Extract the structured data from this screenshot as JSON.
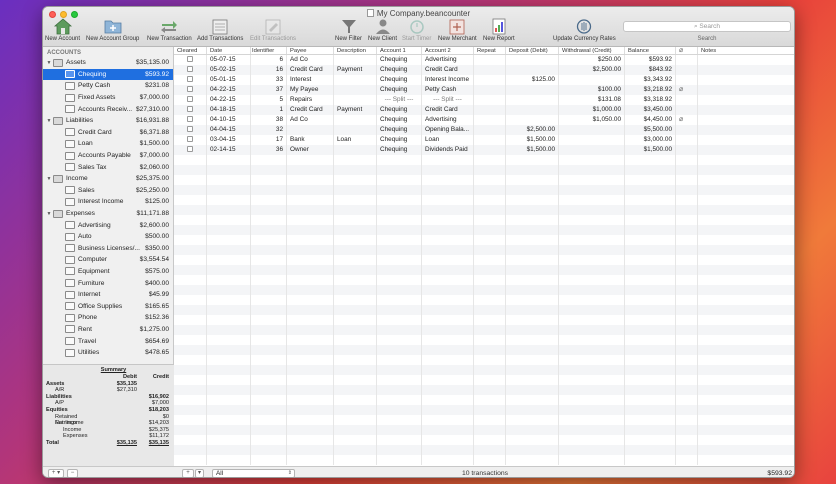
{
  "window": {
    "title": "My Company.beancounter"
  },
  "toolbar": {
    "new_account": "New Account",
    "new_account_group": "New Account Group",
    "new_transaction": "New Transaction",
    "add_transactions": "Add Transactions",
    "edit_transactions": "Edit Transactions",
    "new_filter": "New Filter",
    "new_client": "New Client",
    "start_timer": "Start Timer",
    "new_merchant": "New Merchant",
    "new_report": "New Report",
    "update_currency_rates": "Update Currency Rates",
    "search_placeholder": "Search",
    "search_label": "Search"
  },
  "sidebar": {
    "heading": "ACCOUNTS",
    "tree": [
      {
        "name": "Assets",
        "amount": "$35,135.00",
        "level": 0,
        "group": true
      },
      {
        "name": "Chequing",
        "amount": "$593.92",
        "level": 1,
        "selected": true
      },
      {
        "name": "Petty Cash",
        "amount": "$231.08",
        "level": 1
      },
      {
        "name": "Fixed Assets",
        "amount": "$7,000.00",
        "level": 1
      },
      {
        "name": "Accounts Receiv...",
        "amount": "$27,310.00",
        "level": 1
      },
      {
        "name": "Liabilities",
        "amount": "$16,931.88",
        "level": 0,
        "group": true
      },
      {
        "name": "Credit Card",
        "amount": "$6,371.88",
        "level": 1
      },
      {
        "name": "Loan",
        "amount": "$1,500.00",
        "level": 1
      },
      {
        "name": "Accounts Payable",
        "amount": "$7,000.00",
        "level": 1
      },
      {
        "name": "Sales Tax",
        "amount": "$2,060.00",
        "level": 1
      },
      {
        "name": "Income",
        "amount": "$25,375.00",
        "level": 0,
        "group": true
      },
      {
        "name": "Sales",
        "amount": "$25,250.00",
        "level": 1
      },
      {
        "name": "Interest Income",
        "amount": "$125.00",
        "level": 1
      },
      {
        "name": "Expenses",
        "amount": "$11,171.88",
        "level": 0,
        "group": true
      },
      {
        "name": "Advertising",
        "amount": "$2,600.00",
        "level": 1
      },
      {
        "name": "Auto",
        "amount": "$500.00",
        "level": 1
      },
      {
        "name": "Business Licenses/...",
        "amount": "$350.00",
        "level": 1
      },
      {
        "name": "Computer",
        "amount": "$3,554.54",
        "level": 1
      },
      {
        "name": "Equipment",
        "amount": "$575.00",
        "level": 1
      },
      {
        "name": "Furniture",
        "amount": "$400.00",
        "level": 1
      },
      {
        "name": "Internet",
        "amount": "$45.99",
        "level": 1
      },
      {
        "name": "Office Supplies",
        "amount": "$165.65",
        "level": 1
      },
      {
        "name": "Phone",
        "amount": "$152.36",
        "level": 1
      },
      {
        "name": "Rent",
        "amount": "$1,275.00",
        "level": 1
      },
      {
        "name": "Travel",
        "amount": "$654.69",
        "level": 1
      },
      {
        "name": "Utilities",
        "amount": "$478.65",
        "level": 1
      }
    ],
    "summary": {
      "title": "Summary",
      "debit_label": "Debit",
      "credit_label": "Credit",
      "rows": [
        {
          "label": "Assets",
          "debit": "$35,135",
          "credit": "",
          "bold": true
        },
        {
          "label": "A/R",
          "debit": "$27,310",
          "credit": "",
          "indent": 1
        },
        {
          "label": "Liabilities",
          "debit": "",
          "credit": "$16,902",
          "bold": true
        },
        {
          "label": "A/P",
          "debit": "",
          "credit": "$7,000",
          "indent": 1
        },
        {
          "label": "Equities",
          "debit": "",
          "credit": "$18,203",
          "bold": true
        },
        {
          "label": "Retained Earnings",
          "debit": "",
          "credit": "$0",
          "indent": 1
        },
        {
          "label": "Net Income",
          "debit": "",
          "credit": "$14,203",
          "indent": 1
        },
        {
          "label": "Income",
          "debit": "",
          "credit": "$25,375",
          "indent": 2
        },
        {
          "label": "Expenses",
          "debit": "",
          "credit": "$11,172",
          "indent": 2
        },
        {
          "label": "Total",
          "debit": "$35,135",
          "credit": "$35,135",
          "bold": true,
          "underline": true
        }
      ]
    },
    "footer": {
      "add_label": "+ ▾",
      "remove_label": "−"
    }
  },
  "table": {
    "columns": [
      "Cleared",
      "Date",
      "Identifier",
      "Payee",
      "Description",
      "Account 1",
      "Account 2",
      "Repeat",
      "Deposit (Debit)",
      "Withdrawal (Credit)",
      "Balance",
      "",
      "Notes"
    ],
    "sort_indicator": "⌄",
    "rows": [
      {
        "date": "05-07-15",
        "id": "6",
        "payee": "Ad Co",
        "desc": "",
        "a1": "Chequing",
        "a2": "Advertising",
        "dep": "",
        "wd": "$250.00",
        "bal": "$593.92",
        "att": false
      },
      {
        "date": "05-02-15",
        "id": "16",
        "payee": "Credit Card",
        "desc": "Payment",
        "a1": "Chequing",
        "a2": "Credit Card",
        "dep": "",
        "wd": "$2,500.00",
        "bal": "$843.92",
        "att": false
      },
      {
        "date": "05-01-15",
        "id": "33",
        "payee": "Interest",
        "desc": "",
        "a1": "Chequing",
        "a2": "Interest Income",
        "dep": "$125.00",
        "wd": "",
        "bal": "$3,343.92",
        "att": false
      },
      {
        "date": "04-22-15",
        "id": "37",
        "payee": "My Payee",
        "desc": "",
        "a1": "Chequing",
        "a2": "Petty Cash",
        "dep": "",
        "wd": "$100.00",
        "bal": "$3,218.92",
        "att": true
      },
      {
        "date": "04-22-15",
        "id": "5",
        "payee": "Repairs",
        "desc": "",
        "a1": "--- Split ---",
        "a2": "--- Split ---",
        "dep": "",
        "wd": "$131.08",
        "bal": "$3,318.92",
        "att": false,
        "split": true
      },
      {
        "date": "04-18-15",
        "id": "1",
        "payee": "Credit Card",
        "desc": "Payment",
        "a1": "Chequing",
        "a2": "Credit Card",
        "dep": "",
        "wd": "$1,000.00",
        "bal": "$3,450.00",
        "att": false
      },
      {
        "date": "04-10-15",
        "id": "38",
        "payee": "Ad Co",
        "desc": "",
        "a1": "Chequing",
        "a2": "Advertising",
        "dep": "",
        "wd": "$1,050.00",
        "bal": "$4,450.00",
        "att": true
      },
      {
        "date": "04-04-15",
        "id": "32",
        "payee": "",
        "desc": "",
        "a1": "Chequing",
        "a2": "Opening Bala...",
        "dep": "$2,500.00",
        "wd": "",
        "bal": "$5,500.00",
        "att": false
      },
      {
        "date": "03-04-15",
        "id": "17",
        "payee": "Bank",
        "desc": "Loan",
        "a1": "Chequing",
        "a2": "Loan",
        "dep": "$1,500.00",
        "wd": "",
        "bal": "$3,000.00",
        "att": false
      },
      {
        "date": "02-14-15",
        "id": "36",
        "payee": "Owner",
        "desc": "",
        "a1": "Chequing",
        "a2": "Dividends Paid",
        "dep": "$1,500.00",
        "wd": "",
        "bal": "$1,500.00",
        "att": false
      }
    ]
  },
  "footer": {
    "add_label": "+",
    "filter_value": "All",
    "count_text": "10 transactions",
    "balance": "$593.92"
  }
}
